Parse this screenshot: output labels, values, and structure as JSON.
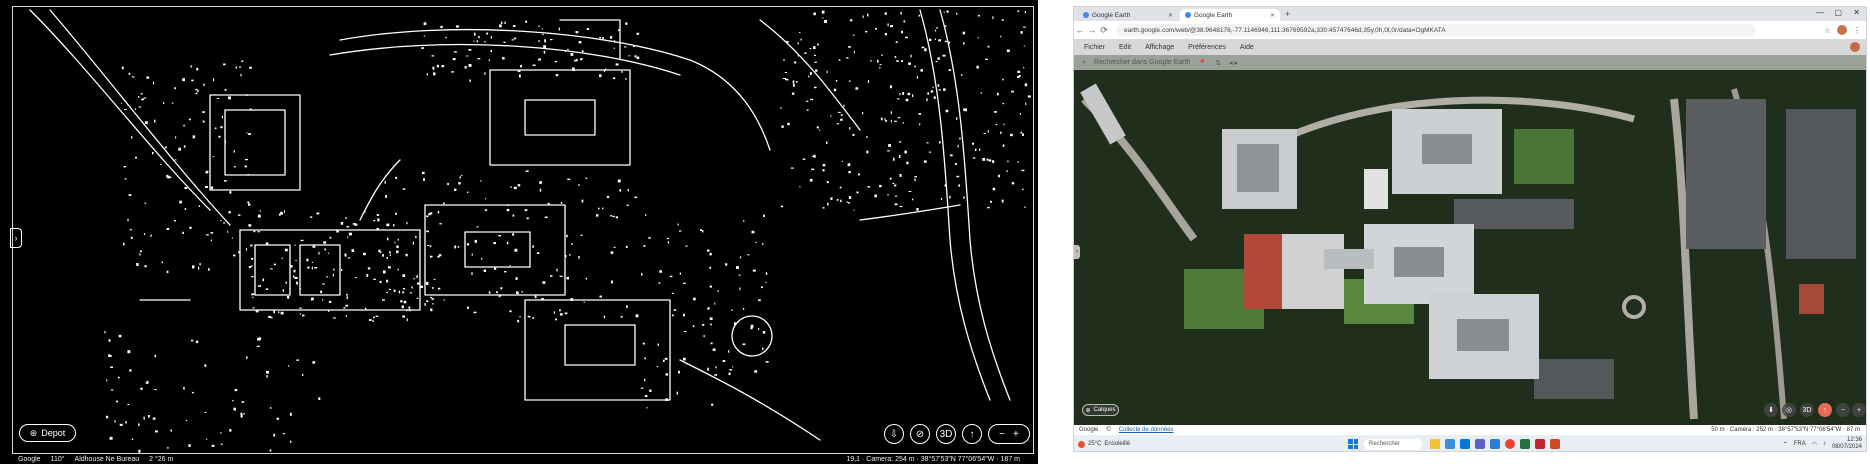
{
  "edge_view": {
    "places_button": "Depot",
    "side_tab": "›",
    "status_left": [
      "Google",
      "110°",
      "Aldhouse Ne Bureau",
      "2 °26 m"
    ],
    "status_right": "19,1 · Camera: 254 m · 38°57'53\"N 77°06'54\"W · 187 m",
    "controls": [
      "⇩",
      "⊘",
      "3D",
      "↑",
      "−",
      "+"
    ]
  },
  "browser": {
    "tabs": [
      {
        "label": "Google Earth",
        "active": false
      },
      {
        "label": "Google Earth",
        "active": true
      }
    ],
    "new_tab": "+",
    "window_controls": [
      "—",
      "▢",
      "✕"
    ],
    "nav": [
      "←",
      "→",
      "⟳"
    ],
    "url": "earth.google.com/web/@38.9648176,-77.1146946,111.36769592a,330.45747646d,35y,0h,0t,0r/data=OgMKATA",
    "toolbar_icons": [
      "☆",
      "⋮"
    ],
    "menu": [
      "Fichier",
      "Edit",
      "Affichage",
      "Préférences",
      "Aide"
    ],
    "search_text": "Rechercher dans Google Earth",
    "search_icons": [
      "📍",
      "⇅",
      "◂ ▸"
    ],
    "left_tab": "›",
    "map_button": "Calques",
    "map_controls": [
      "⬇",
      "◎",
      "3D",
      "↑",
      "−",
      "+"
    ],
    "map_status_left": [
      "Google",
      "©",
      "Collecte de données"
    ],
    "map_status_right": "50 m · Caméra : 252 m · 38°57'53\"N 77°06'54\"W · 87 m"
  },
  "taskbar": {
    "weather_temp": "25°C",
    "weather_desc": "Ensoleillé",
    "search_placeholder": "Rechercher",
    "time": "12:36",
    "date": "08/07/2024",
    "lang": "FRA"
  },
  "colors": {
    "edge_bg": "#000000",
    "edge_line": "#ffffff",
    "roof_gray": "#c9cccf",
    "roof_red": "#b2483a",
    "tree_green": "#23361d",
    "lawn_green": "#4f7a3a"
  }
}
